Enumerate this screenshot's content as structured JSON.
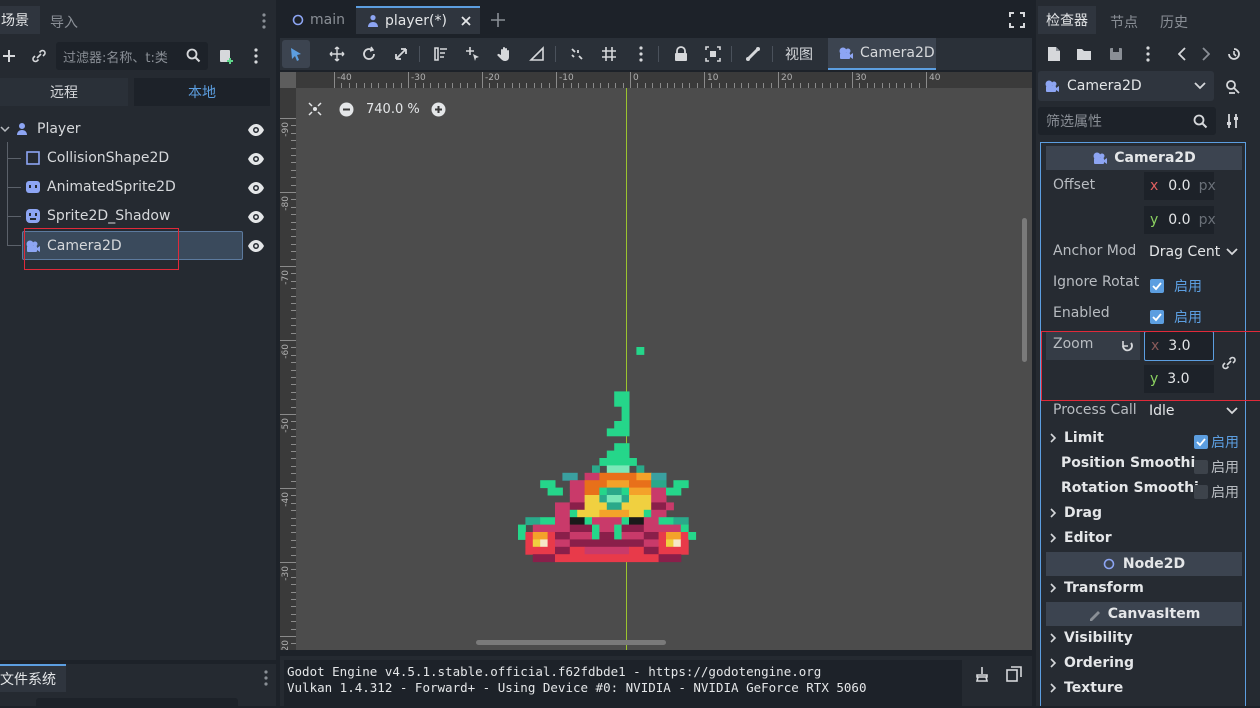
{
  "left_dock": {
    "tabs": [
      "场景",
      "导入"
    ],
    "filter_placeholder": "过滤器:名称、t:类",
    "remote_tab": "远程",
    "local_tab": "本地",
    "tree": [
      {
        "label": "Player",
        "icon": "player-node-icon",
        "selected": false
      },
      {
        "label": "CollisionShape2D",
        "icon": "collision-shape-icon",
        "selected": false
      },
      {
        "label": "AnimatedSprite2D",
        "icon": "animated-sprite-icon",
        "selected": false
      },
      {
        "label": "Sprite2D_Shadow",
        "icon": "sprite-icon",
        "selected": false
      },
      {
        "label": "Camera2D",
        "icon": "camera-icon",
        "selected": true
      }
    ],
    "filesystem_tab": "文件系统"
  },
  "editor_tabs": [
    {
      "label": "main",
      "active": false
    },
    {
      "label": "player(*)",
      "active": true
    }
  ],
  "toolbar": {
    "view_label": "视图",
    "camera_label": "Camera2D"
  },
  "viewport": {
    "zoom_text": "740.0 %",
    "ruler_top": [
      "-40",
      "-30",
      "-20",
      "-10",
      "0",
      "10",
      "20",
      "30",
      "40"
    ],
    "ruler_left": [
      "-90",
      "-80",
      "-70",
      "-60",
      "-50",
      "-40",
      "-30",
      "-20"
    ]
  },
  "output": {
    "line1": "Godot Engine v4.5.1.stable.official.f62fdbde1 - https://godotengine.org",
    "line2": "Vulkan 1.4.312 - Forward+ - Using Device #0: NVIDIA - NVIDIA GeForce RTX 5060"
  },
  "inspector": {
    "tabs": [
      "检查器",
      "节点",
      "历史"
    ],
    "node_name": "Camera2D",
    "filter_placeholder": "筛选属性",
    "section_title": "Camera2D",
    "offset_label": "Offset",
    "offset_x": "0.0",
    "offset_y": "0.0",
    "unit": "px",
    "anchor_label": "Anchor Mod",
    "anchor_value": "Drag Cent",
    "ignore_rot_label": "Ignore Rotat",
    "enabled_label": "Enabled",
    "on_label": "启用",
    "zoom_label": "Zoom",
    "zoom_x": "3.0",
    "zoom_y": "3.0",
    "process_label": "Process Call",
    "process_value": "Idle",
    "limit_label": "Limit",
    "pos_smooth_label": "Position Smoothi",
    "rot_smooth_label": "Rotation Smoothi",
    "drag_label": "Drag",
    "editor_label": "Editor",
    "node2d_label": "Node2D",
    "transform_label": "Transform",
    "canvasitem_label": "CanvasItem",
    "visibility_label": "Visibility",
    "ordering_label": "Ordering",
    "texture_label": "Texture",
    "axis_x": "x",
    "axis_y": "y"
  },
  "colors": {
    "accent": "#5c9ee0",
    "panel": "#252a31",
    "viewport": "#4c4c4c",
    "highlight_box": "#e02a3a",
    "axis_green": "#9bc42f"
  }
}
